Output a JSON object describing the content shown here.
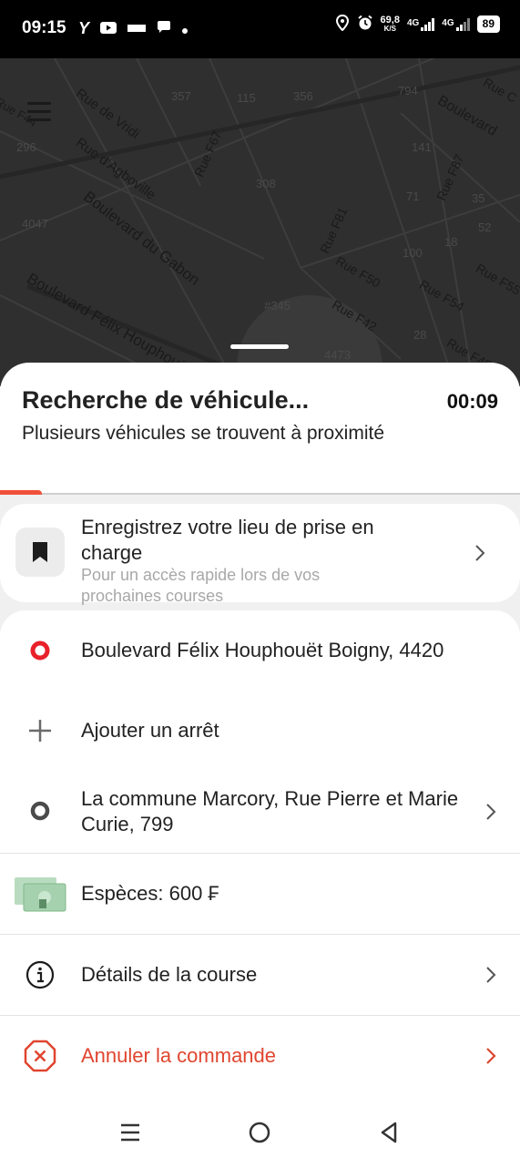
{
  "status_bar": {
    "time": "09:15",
    "speed_value": "69,8",
    "speed_unit": "K/S",
    "net1": "4G",
    "net2": "4G",
    "battery": "89"
  },
  "map": {
    "streets": [
      "Rue de Vridi",
      "Rue d'Agboville",
      "Boulevard du Gabon",
      "Boulevard Félix Houphouët",
      "Rue F67",
      "Rue F81",
      "Rue F87",
      "Rue F50",
      "Rue F42",
      "Rue F54",
      "Rue F55",
      "Rue F48",
      "Boulevard",
      "Rue C",
      "Rue F44"
    ],
    "numbers": [
      "357",
      "115",
      "356",
      "794",
      "141",
      "308",
      "71",
      "35",
      "52",
      "4047",
      "296",
      "100",
      "18",
      "28",
      "#345",
      "4473"
    ]
  },
  "sheet": {
    "title": "Recherche de véhicule...",
    "timer": "00:09",
    "subtitle": "Plusieurs véhicules se trouvent à proximité",
    "progress": 0.08
  },
  "save_card": {
    "title": "Enregistrez votre lieu de prise en charge",
    "subtitle": "Pour un accès rapide lors de vos prochaines courses",
    "icon": "bookmark-icon"
  },
  "route": {
    "pickup": "Boulevard Félix Houphouët Boigny, 4420",
    "add_stop": "Ajouter un arrêt",
    "destination": "La commune Marcory, Rue Pierre et Marie Curie, 799",
    "payment": "Espèces: 600 ₣",
    "details": "Détails de la course",
    "cancel": "Annuler la commande"
  },
  "colors": {
    "accent": "#e0452f",
    "map_bg": "#2f2f2f",
    "sheet_bg": "#ffffff"
  }
}
